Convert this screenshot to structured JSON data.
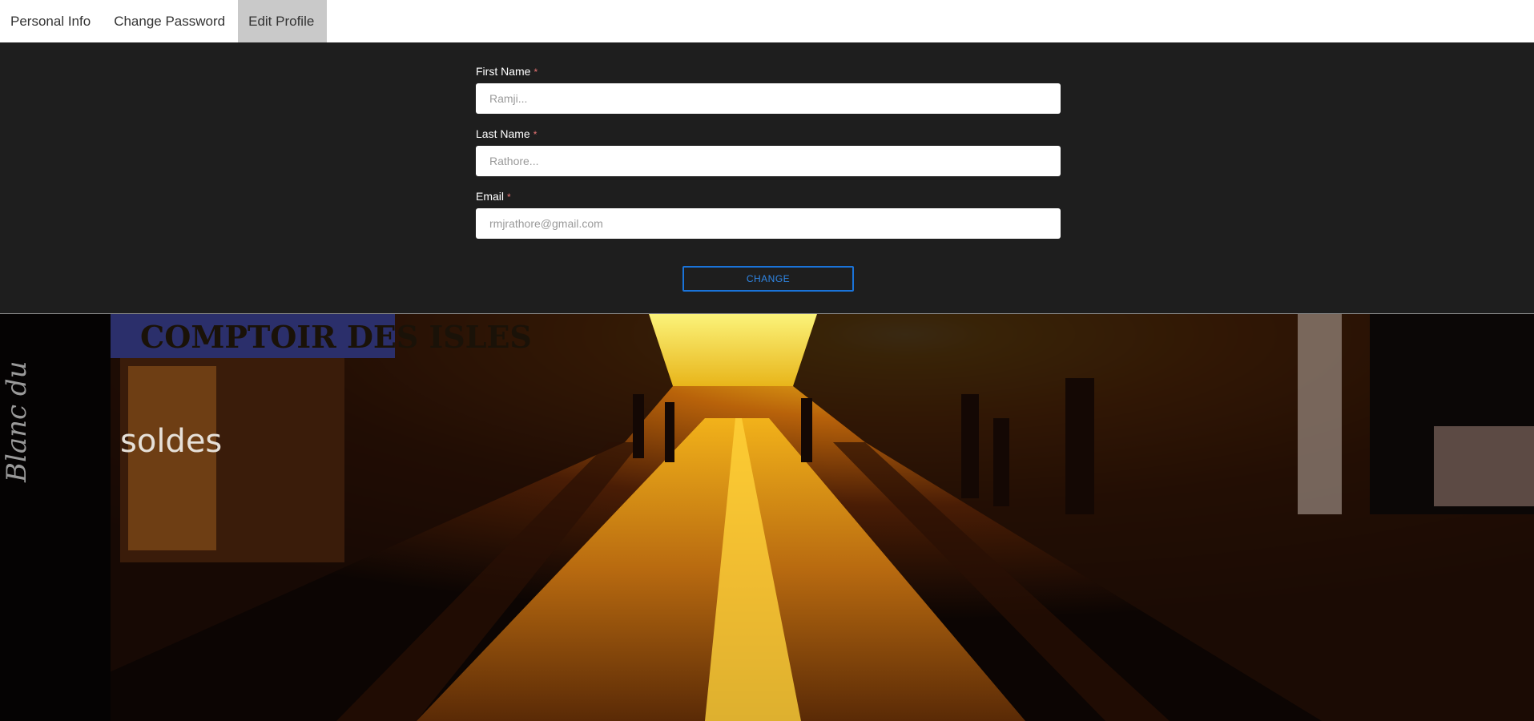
{
  "tabs": [
    {
      "label": "Personal Info",
      "active": false
    },
    {
      "label": "Change Password",
      "active": false
    },
    {
      "label": "Edit Profile",
      "active": true
    }
  ],
  "form": {
    "first_name": {
      "label": "First Name",
      "required_mark": "*",
      "placeholder": "Ramji..."
    },
    "last_name": {
      "label": "Last Name",
      "required_mark": "*",
      "placeholder": "Rathore..."
    },
    "email": {
      "label": "Email",
      "required_mark": "*",
      "placeholder": "rmjrathore@gmail.com"
    },
    "submit_label": "CHANGE"
  },
  "banner": {
    "shop_sign": "COMPTOIR DES ISLES",
    "window_text": "soldes",
    "side_script": "Blanc du"
  },
  "colors": {
    "panel_bg": "#1e1e1e",
    "active_tab_bg": "#c9c9c9",
    "accent": "#1a73d9",
    "required": "#e57373"
  }
}
